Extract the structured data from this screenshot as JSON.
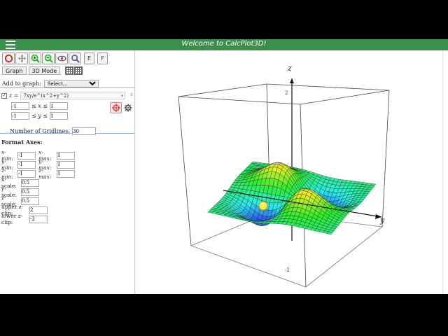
{
  "app": {
    "title": "Welcome to CalcPlot3D!"
  },
  "toolbar": {
    "e_label": "E",
    "f_label": "F"
  },
  "tabs": [
    {
      "label": "Graph"
    },
    {
      "label": "3D Mode"
    }
  ],
  "add_graph": {
    "label": "Add to graph:",
    "selected": "Select..."
  },
  "function": {
    "checked": "✓",
    "prefix": "z =",
    "expression": "7xy/e^(x^2+y^2)",
    "close": "x",
    "x_min": "-1",
    "x_max": "1",
    "y_min": "-1",
    "y_max": "1",
    "x_range_label": "≤ x ≤",
    "y_range_label": "≤ y ≤",
    "gridlines_label": "Number of Gridlines:",
    "gridlines": "30"
  },
  "format_axes": {
    "title": "Format Axes:",
    "x_min_label": "x-min:",
    "x_min": "-1",
    "x_max_label": "x-max:",
    "x_max": "1",
    "y_min_label": "y-min:",
    "y_min": "-1",
    "y_max_label": "y-max:",
    "y_max": "1",
    "z_min_label": "z-min:",
    "z_min": "-1",
    "z_max_label": "z-max:",
    "z_max": "1",
    "x_scale_label": "x-scale:",
    "x_scale": "0.5",
    "y_scale_label": "y-scale:",
    "y_scale": "0.5",
    "z_scale_label": "z-scale:",
    "z_scale": "0.5",
    "upper_clip_label": "upper z-clip:",
    "upper_clip": "2",
    "lower_clip_label": "lower z-clip:",
    "lower_clip": "-2"
  },
  "axes": {
    "z_label": "z",
    "y_label": "y",
    "z_tick_top": "2",
    "z_tick_bottom": "-2"
  },
  "colors": {
    "titlebar": "#3a8f4a",
    "plot_button": "#fbe4e4"
  }
}
